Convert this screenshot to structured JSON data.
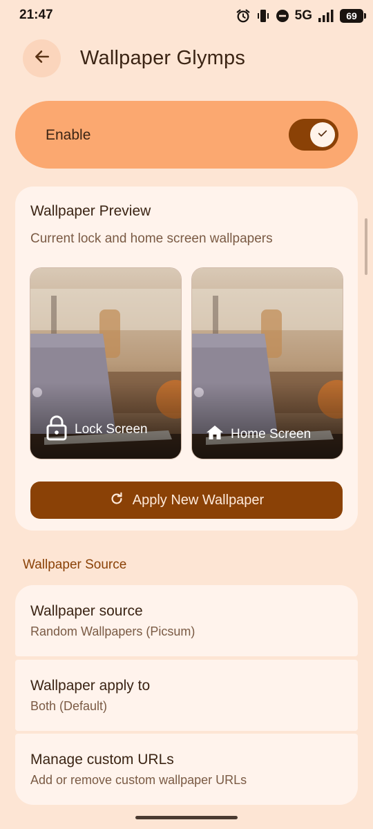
{
  "status_bar": {
    "time": "21:47",
    "network": "5G",
    "battery": "69",
    "icons": [
      "alarm-icon",
      "vibrate-icon",
      "do-not-disturb-icon",
      "signal-icon",
      "battery-icon"
    ]
  },
  "header": {
    "back_icon": "arrow-left-icon",
    "title": "Wallpaper Glymps"
  },
  "enable": {
    "label": "Enable",
    "toggle_on": true
  },
  "preview": {
    "title": "Wallpaper Preview",
    "subtitle": "Current lock and home screen wallpapers",
    "lock_label": "Lock Screen",
    "home_label": "Home Screen",
    "apply_label": "Apply New Wallpaper"
  },
  "source_section": {
    "header": "Wallpaper Source",
    "items": [
      {
        "title": "Wallpaper source",
        "subtitle": "Random Wallpapers (Picsum)"
      },
      {
        "title": "Wallpaper apply to",
        "subtitle": "Both (Default)"
      },
      {
        "title": "Manage custom URLs",
        "subtitle": "Add or remove custom wallpaper URLs"
      }
    ]
  },
  "colors": {
    "background": "#fde5d4",
    "accent": "#8a4106",
    "enable_card": "#fba870",
    "card": "#fff3ec",
    "section_header": "#8a4106"
  }
}
